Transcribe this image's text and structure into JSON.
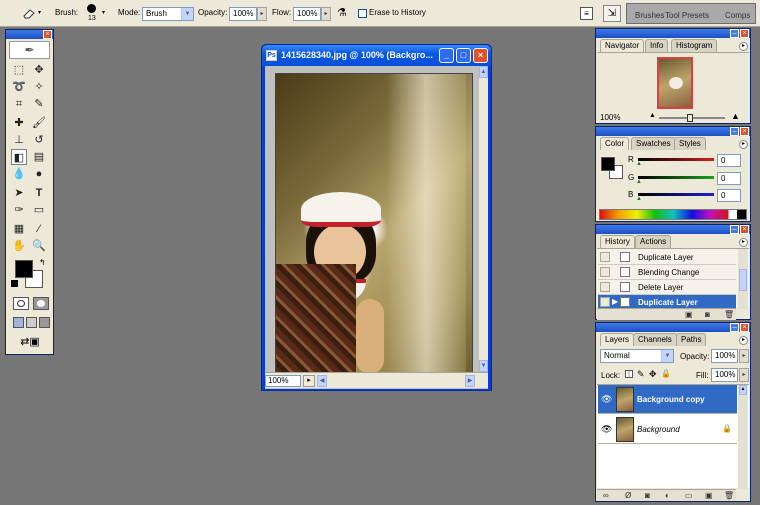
{
  "options_bar": {
    "brush_label": "Brush:",
    "brush_size": "13",
    "mode_label": "Mode:",
    "mode_value": "Brush",
    "opacity_label": "Opacity:",
    "opacity_value": "100%",
    "flow_label": "Flow:",
    "flow_value": "100%",
    "erase_history_label": "Erase to History",
    "well_tabs": [
      "Brushes",
      "Tool Presets",
      "Comps"
    ]
  },
  "document": {
    "title": "1415628340.jpg @ 100% (Backgro...",
    "zoom": "100%"
  },
  "navigator": {
    "tabs": [
      "Navigator",
      "Info",
      "Histogram"
    ],
    "zoom": "100%"
  },
  "color": {
    "tabs": [
      "Color",
      "Swatches",
      "Styles"
    ],
    "channels": [
      {
        "label": "R",
        "value": "0",
        "color": "#D42020"
      },
      {
        "label": "G",
        "value": "0",
        "color": "#20A020"
      },
      {
        "label": "B",
        "value": "0",
        "color": "#2020D0"
      }
    ]
  },
  "history": {
    "tabs": [
      "History",
      "Actions"
    ],
    "items": [
      "Duplicate Layer",
      "Blending Change",
      "Delete Layer",
      "Duplicate Layer"
    ],
    "selected_index": 3
  },
  "layers": {
    "tabs": [
      "Layers",
      "Channels",
      "Paths"
    ],
    "blend_mode": "Normal",
    "opacity_label": "Opacity:",
    "opacity_value": "100%",
    "lock_label": "Lock:",
    "fill_label": "Fill:",
    "fill_value": "100%",
    "items": [
      "Background copy",
      "Background"
    ],
    "selected_index": 0
  },
  "colors": {
    "title_bar": "#0858E2",
    "selection": "#316AC5",
    "workspace": "#767676"
  }
}
